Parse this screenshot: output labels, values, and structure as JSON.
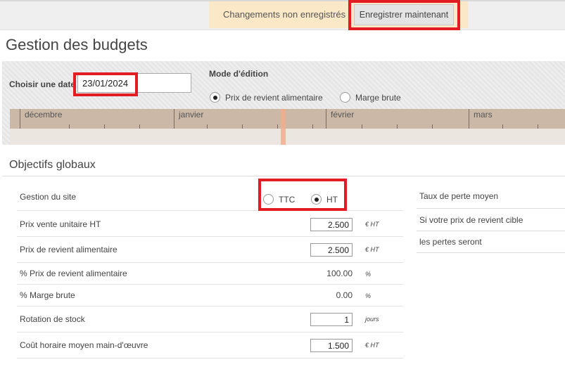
{
  "header": {
    "unsaved_text": "Changements non enregistrés",
    "save_button": "Enregistrer maintenant"
  },
  "page": {
    "title": "Gestion des budgets"
  },
  "controls": {
    "date_label": "Choisir une date",
    "date_value": "23/01/2024",
    "mode_label": "Mode d'édition",
    "mode_options": [
      {
        "label": "Prix de revient alimentaire",
        "selected": true
      },
      {
        "label": "Marge brute",
        "selected": false
      }
    ]
  },
  "timeline": {
    "months": [
      "décembre",
      "janvier",
      "février",
      "mars"
    ]
  },
  "objectifs": {
    "title": "Objectifs globaux",
    "site_label": "Gestion du site",
    "tax_options": [
      {
        "label": "TTC",
        "selected": false
      },
      {
        "label": "HT",
        "selected": true
      }
    ],
    "rows": [
      {
        "label": "Prix vente unitaire HT",
        "value": "2.500",
        "unit": "€ HT"
      },
      {
        "label": "Prix de revient alimentaire",
        "value": "2.500",
        "unit": "€ HT"
      },
      {
        "label": "% Prix de revient alimentaire",
        "value": "100.00",
        "unit": "%"
      },
      {
        "label": "% Marge brute",
        "value": "0.00",
        "unit": "%"
      },
      {
        "label": "Rotation de stock",
        "value": "1",
        "unit": "jours"
      },
      {
        "label": "Coût horaire moyen main-d'œuvre",
        "value": "1.500",
        "unit": "€ HT"
      }
    ]
  },
  "side_panel": {
    "items": [
      "Taux de perte moyen",
      "Si votre prix de revient cible",
      "les pertes seront"
    ]
  },
  "colors": {
    "highlight": "#e31b23",
    "unsaved_bg": "#fbe8c6",
    "timeline": "#cbb8a7"
  }
}
